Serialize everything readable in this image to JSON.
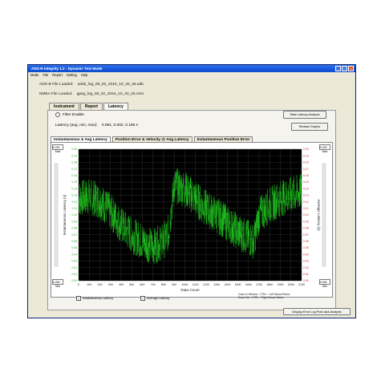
{
  "window": {
    "title": "ADS-R Integrity 1.2 - Dynamic Test Mode",
    "menu": [
      "Mode",
      "File",
      "Report",
      "Setting",
      "Help"
    ]
  },
  "files": {
    "adsb_label": "ADS-B File Loaded:",
    "adsb_value": "adsb_log_08_02_2016_10_40_26.adb",
    "nmea_label": "NMEA File Loaded:",
    "nmea_value": "gpsg_log_08_02_2016_10_40_26.nme"
  },
  "tabs": [
    {
      "label": "Instrument",
      "active": false
    },
    {
      "label": "Report",
      "active": false
    },
    {
      "label": "Latency",
      "active": true
    }
  ],
  "filter": {
    "label": "Filter Enable"
  },
  "latency": {
    "label": "Latency (avg, min, max):",
    "value": "0.091, 0.002, 0.186 s"
  },
  "buttons": {
    "start": "Start Latency Analysis",
    "redraw": "Redraw Graphs",
    "display_error": "Display Error Log Post-task Analysis"
  },
  "subtabs": [
    {
      "label": "Instantaneous & Avg Latency",
      "active": true
    },
    {
      "label": "Position Error & Velocity @ Avg Latency",
      "active": false
    },
    {
      "label": "Instantaneous Position Error",
      "active": false
    }
  ],
  "side_controls": {
    "left_top_value": "0.200",
    "left_top_label": "Max",
    "left_bottom_value": "0.000",
    "left_bottom_label": "Min",
    "right_top_value": "0.200",
    "right_top_label": "Max",
    "right_bottom_value": "0.000",
    "right_bottom_label": "Min"
  },
  "checkboxes": [
    {
      "label": "Instantaneous Latency",
      "checked": true
    },
    {
      "label": "Average Latency",
      "checked": true
    }
  ],
  "zoom_notes": {
    "line1": "Zoom-In Window - CTRL + Left Mouse Button",
    "line2": "Zoom Out - CTRL + Right Mouse Button"
  },
  "colors": {
    "plot_bg": "#000000",
    "trace": "#22dd22",
    "left_ticks": "#22aa22",
    "right_ticks": "#cc2222",
    "titlebar": "#0a4bd0"
  },
  "chart_data": {
    "type": "line",
    "xlabel": "Data Count",
    "ylabel_left": "Instantaneous Latency (s)",
    "ylabel_right": "Average Latency (s)",
    "xlim": [
      0,
      2100
    ],
    "ylim": [
      0,
      0.2
    ],
    "x_ticks": [
      "0",
      "100",
      "200",
      "300",
      "400",
      "500",
      "600",
      "700",
      "800",
      "900",
      "1000",
      "1100",
      "1200",
      "1300",
      "1400",
      "1500",
      "1600",
      "1700",
      "1800",
      "1900",
      "2000",
      "2100"
    ],
    "y_ticks": [
      "0.00",
      "0.01",
      "0.02",
      "0.03",
      "0.04",
      "0.05",
      "0.06",
      "0.07",
      "0.08",
      "0.09",
      "0.10",
      "0.11",
      "0.12",
      "0.13",
      "0.14",
      "0.15",
      "0.16",
      "0.17",
      "0.18",
      "0.19",
      "0.20"
    ],
    "grid": true,
    "series": [
      {
        "name": "Instantaneous Latency",
        "center": [
          [
            0,
            0.125
          ],
          [
            100,
            0.128
          ],
          [
            200,
            0.122
          ],
          [
            300,
            0.105
          ],
          [
            400,
            0.085
          ],
          [
            500,
            0.07
          ],
          [
            600,
            0.06
          ],
          [
            700,
            0.052
          ],
          [
            800,
            0.06
          ],
          [
            850,
            0.075
          ],
          [
            900,
            0.145
          ],
          [
            1000,
            0.14
          ],
          [
            1100,
            0.125
          ],
          [
            1200,
            0.11
          ],
          [
            1300,
            0.1
          ],
          [
            1400,
            0.088
          ],
          [
            1500,
            0.075
          ],
          [
            1600,
            0.065
          ],
          [
            1650,
            0.06
          ],
          [
            1700,
            0.1
          ],
          [
            1800,
            0.115
          ],
          [
            1900,
            0.125
          ],
          [
            2000,
            0.13
          ],
          [
            2100,
            0.135
          ]
        ],
        "spread": 0.028
      }
    ]
  }
}
